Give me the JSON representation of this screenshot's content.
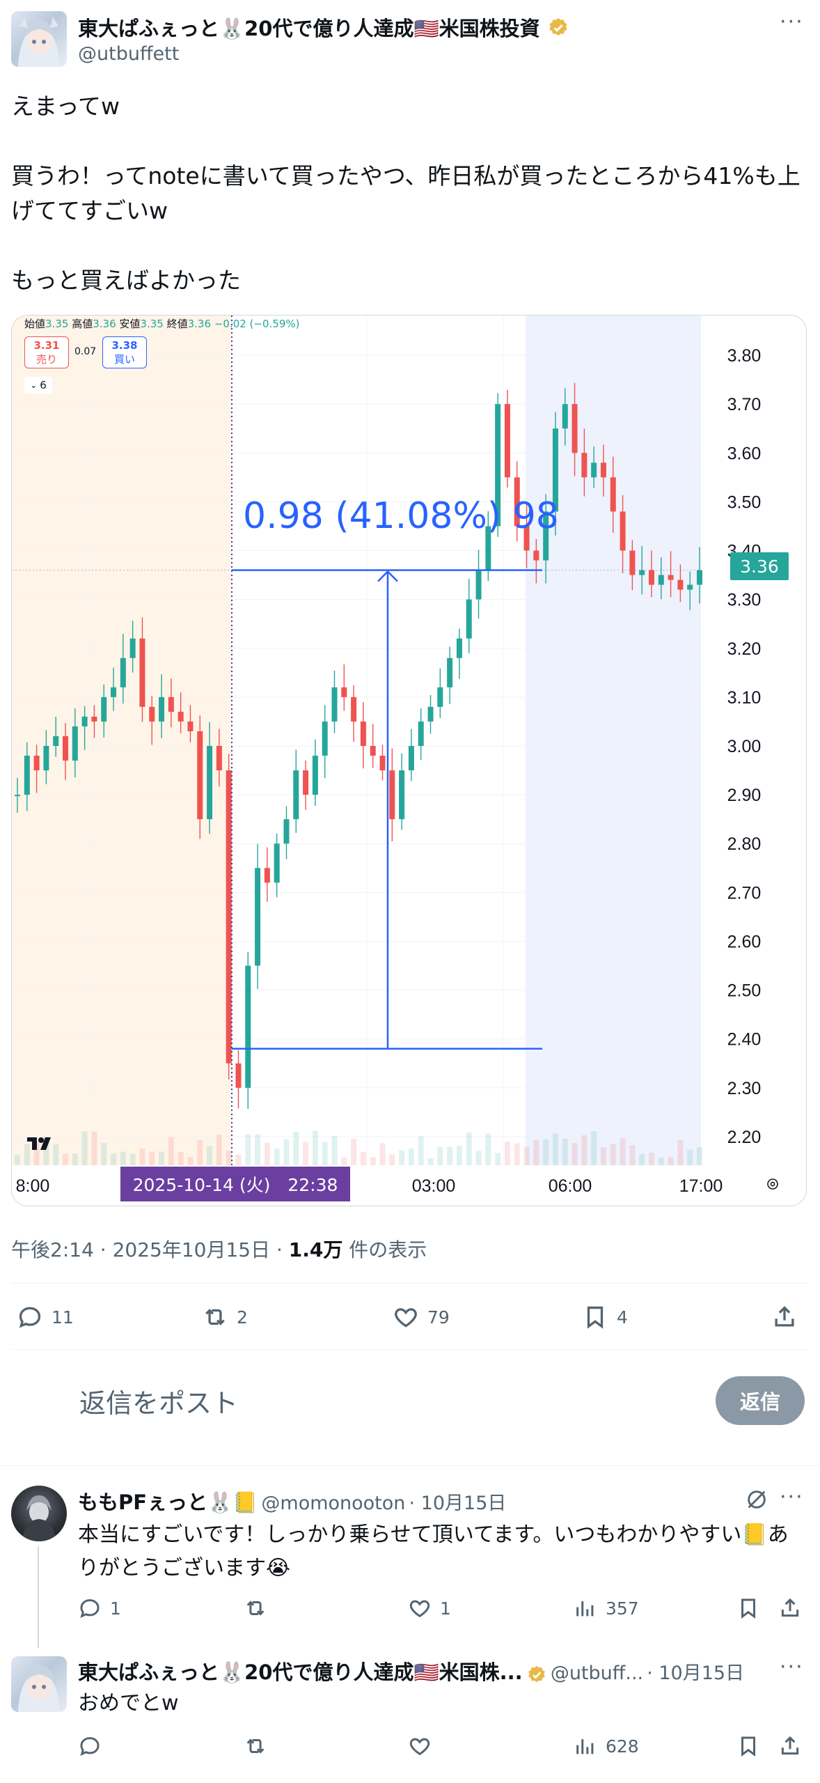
{
  "post": {
    "author_name": "東大ぱふぇっと🐰20代で億り人達成🇺🇸米国株投資",
    "author_handle": "@utbuffett",
    "text": "えまってw\n\n買うわ！ってnoteに書いて買ったやつ、昨日私が買ったところから41%も上げててすごいw\n\nもっと買えばよかった",
    "timestamp": "午後2:14 · 2025年10月15日 · ",
    "views_value": "1.4万",
    "views_label": " 件の表示",
    "replies": "11",
    "reposts": "2",
    "likes": "79",
    "bookmarks": "4"
  },
  "compose": {
    "placeholder": "返信をポスト",
    "button": "返信"
  },
  "replies": [
    {
      "author_name": "ももPFぇっと🐰📒",
      "author_handle": "@momonooton",
      "date": "· 10月15日",
      "text": "本当にすごいです！しっかり乗らせて頂いてます。いつもわかりやすい📒ありがとうございます😭",
      "replies": "1",
      "reposts": "",
      "likes": "1",
      "views": "357"
    },
    {
      "author_name": "東大ぱふぇっと🐰20代で億り人達成🇺🇸米国株...",
      "author_handle": "@utbuff...",
      "date": "· 10月15日",
      "text": "おめでとw",
      "replies": "",
      "reposts": "",
      "likes": "",
      "views": "628"
    }
  ],
  "chart_data": {
    "type": "candlestick",
    "ohlc_header": {
      "open_label": "始値",
      "open": "3.35",
      "high_label": "高値",
      "high": "3.36",
      "low_label": "安値",
      "low": "3.35",
      "close_label": "終値",
      "close": "3.36",
      "change": "−0.02 (−0.59%)"
    },
    "sell_price": "3.31",
    "sell_label": "売り",
    "spread": "0.07",
    "buy_price": "3.38",
    "buy_label": "買い",
    "indicator_toggle": "6",
    "y_ticks": [
      "3.80",
      "3.70",
      "3.60",
      "3.50",
      "3.40",
      "3.30",
      "3.20",
      "3.10",
      "3.00",
      "2.90",
      "2.80",
      "2.70",
      "2.60",
      "2.50",
      "2.40",
      "2.30",
      "2.20"
    ],
    "ylim": [
      2.15,
      3.85
    ],
    "x_ticks": [
      "8:00",
      "03:00",
      "06:00",
      "17:00"
    ],
    "cursor_label": "2025-10-14 (火)　22:38",
    "current_price": "3.36",
    "measure_text": "0.98 (41.08%) 98",
    "measure_from": 2.38,
    "measure_to": 3.36,
    "sessions": [
      "pre-market (shaded orange)",
      "regular",
      "after-hours (shaded blue)"
    ],
    "colors": {
      "up": "#26a69a",
      "down": "#ef5350",
      "measure": "#2962ff",
      "price_tag": "#26a69a",
      "cursor": "#6a1b9a"
    },
    "series": [
      {
        "name": "price",
        "values": [
          2.9,
          2.98,
          2.95,
          3.0,
          3.02,
          2.97,
          3.04,
          3.06,
          3.05,
          3.1,
          3.12,
          3.18,
          3.22,
          3.08,
          3.05,
          3.1,
          3.07,
          3.05,
          3.03,
          2.85,
          3.0,
          2.95,
          2.35,
          2.3,
          2.55,
          2.75,
          2.72,
          2.8,
          2.85,
          2.95,
          2.9,
          2.98,
          3.05,
          3.12,
          3.1,
          3.05,
          3.0,
          2.98,
          2.95,
          2.85,
          2.95,
          3.0,
          3.05,
          3.08,
          3.12,
          3.18,
          3.22,
          3.3,
          3.36,
          3.45,
          3.7,
          3.55,
          3.45,
          3.4,
          3.38,
          3.48,
          3.65,
          3.7,
          3.6,
          3.55,
          3.58,
          3.55,
          3.48,
          3.4,
          3.35,
          3.36,
          3.33,
          3.35,
          3.34,
          3.32,
          3.33,
          3.36
        ]
      }
    ]
  }
}
